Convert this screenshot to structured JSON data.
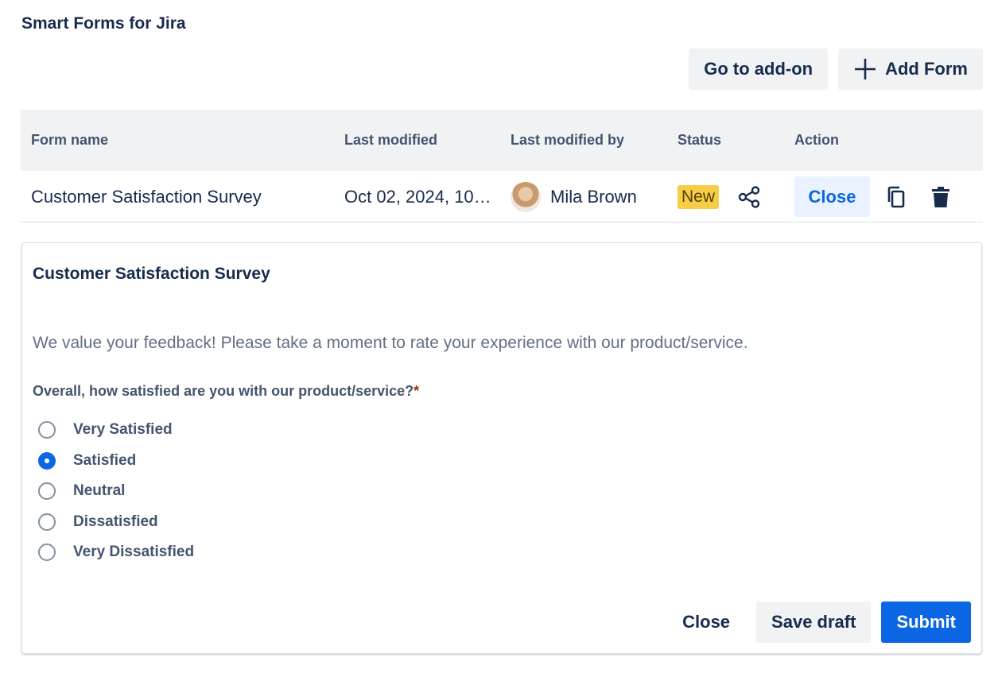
{
  "app": {
    "title": "Smart Forms for Jira"
  },
  "toolbar": {
    "go_to_addon_label": "Go to add-on",
    "add_form_label": "Add Form",
    "add_icon": "plus-icon"
  },
  "table": {
    "headers": {
      "form_name": "Form name",
      "last_modified": "Last modified",
      "last_modified_by": "Last modified by",
      "status": "Status",
      "action": "Action"
    },
    "rows": [
      {
        "form_name": "Customer Satisfaction Survey",
        "last_modified": "Oct 02, 2024, 10:...",
        "last_modified_by": "Mila Brown",
        "status": "New",
        "action_close_label": "Close",
        "icons": [
          "share-icon",
          "copy-icon",
          "trash-icon"
        ]
      }
    ]
  },
  "form": {
    "title": "Customer Satisfaction Survey",
    "description": "We value your feedback! Please take a moment to rate your experience with our product/service.",
    "question": {
      "label": "Overall, how satisfied are you with our product/service?",
      "required_marker": "*",
      "selected": "Satisfied",
      "options": [
        "Very Satisfied",
        "Satisfied",
        "Neutral",
        "Dissatisfied",
        "Very Dissatisfied"
      ]
    },
    "footer": {
      "close_label": "Close",
      "save_draft_label": "Save draft",
      "submit_label": "Submit"
    }
  },
  "colors": {
    "primary": "#0c66e4",
    "badge_new_bg": "#f5cd47",
    "required": "#ae2a19",
    "header_bg": "#f1f2f4"
  }
}
